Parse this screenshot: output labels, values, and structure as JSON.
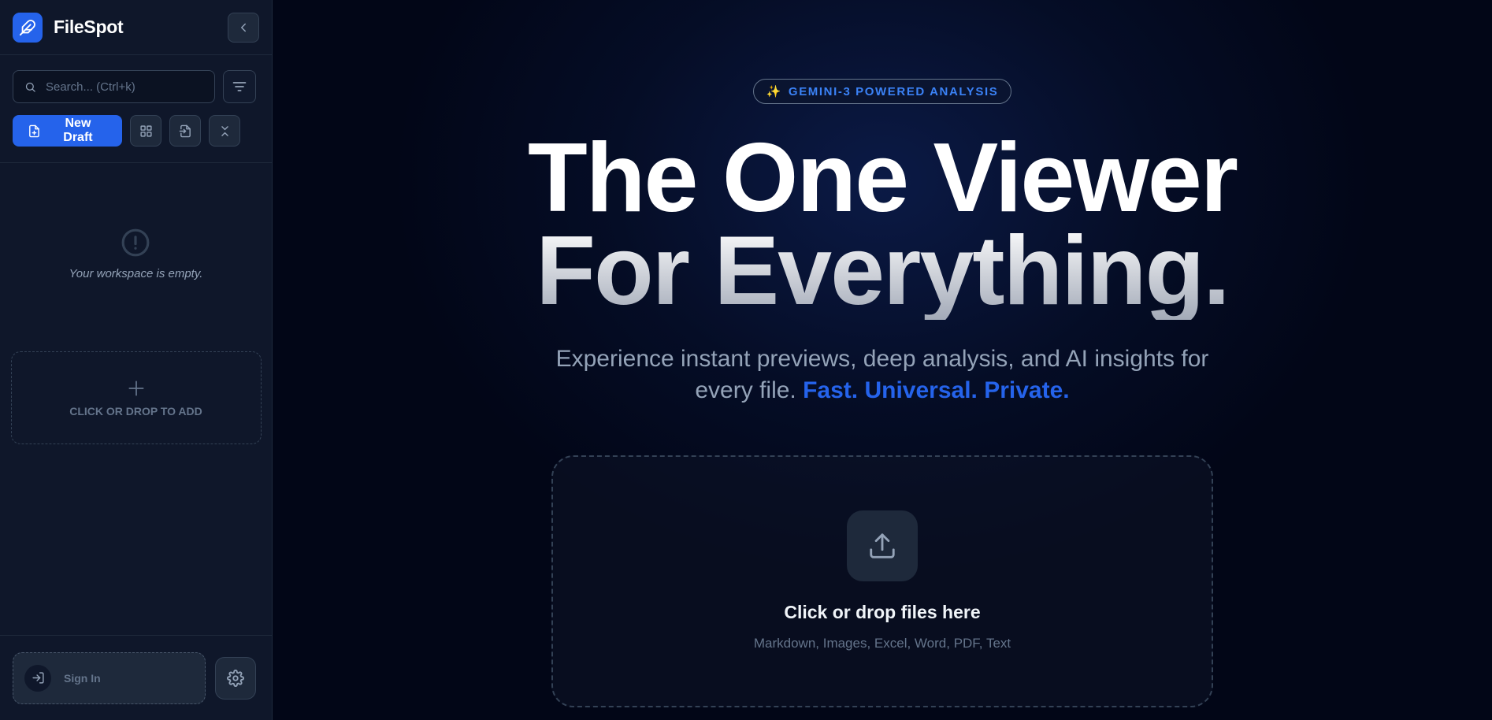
{
  "sidebar": {
    "brand": "FileSpot",
    "search_placeholder": "Search... (Ctrl+k)",
    "new_draft_label": "New Draft",
    "empty_text": "Your workspace is empty.",
    "drop_add_label": "CLICK OR DROP TO ADD",
    "sign_in_label": "Sign In"
  },
  "main": {
    "badge_icon": "✨",
    "badge_text": "GEMINI-3 POWERED ANALYSIS",
    "hero_line1": "The One Viewer",
    "hero_line2": "For Everything.",
    "subtitle_main": "Experience instant previews, deep analysis, and AI insights for every file.",
    "subtitle_accent": "Fast. Universal. Private.",
    "dropzone_title": "Click or drop files here",
    "dropzone_formats": "Markdown, Images, Excel, Word, PDF, Text"
  },
  "colors": {
    "accent": "#2563eb",
    "sidebar_bg": "#0f172a",
    "main_bg": "#020617"
  },
  "icons": {
    "logo": "feather-icon",
    "collapse": "chevron-left-icon",
    "search": "search-icon",
    "filter": "filter-lines-icon",
    "new_draft": "file-plus-icon",
    "grid": "grid-icon",
    "import": "file-import-icon",
    "collapse_all": "chevrons-collapse-icon",
    "empty": "alert-circle-icon",
    "add": "plus-icon",
    "sign_in": "log-in-icon",
    "settings": "gear-icon",
    "upload": "upload-icon"
  }
}
